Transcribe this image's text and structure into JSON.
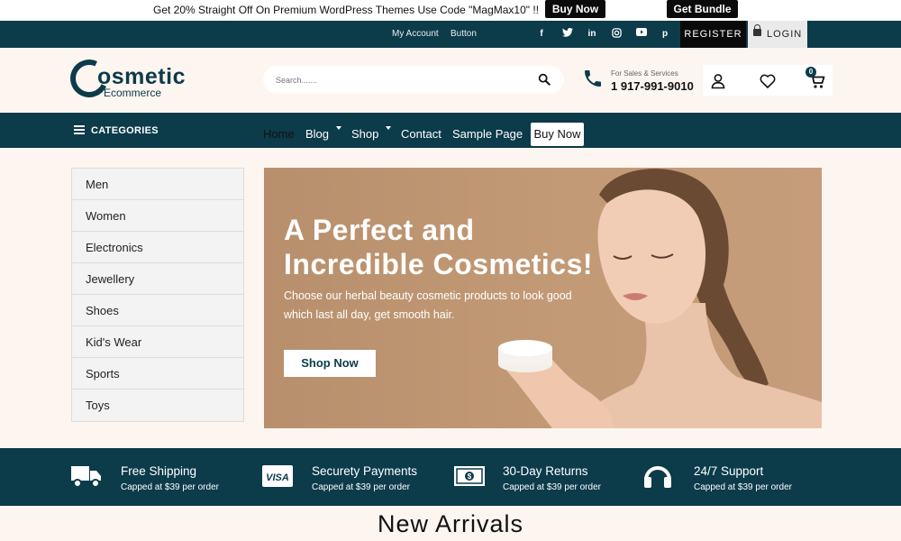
{
  "promo": {
    "text": "Get 20% Straight Off On Premium WordPress Themes Use Code \"MagMax10\" !!",
    "buy_now": "Buy Now",
    "get_bundle": "Get Bundle"
  },
  "topbar": {
    "my_account": "My Account",
    "button": "Button",
    "social": [
      "f",
      "t",
      "in",
      "ig",
      "yt",
      "p"
    ],
    "register": "REGISTER",
    "login": "LOGIN"
  },
  "header": {
    "logo_word": "osmetic",
    "logo_sub": "Ecommerce",
    "search_placeholder": "Search.......",
    "sales_label": "For Sales & Services",
    "phone": "1 917-991-9010",
    "cart_count": "0"
  },
  "nav": {
    "categories": "CATEGORIES",
    "links": [
      "Home",
      "Blog",
      "Shop",
      "Contact",
      "Sample Page"
    ],
    "buy_now": "Buy Now"
  },
  "sidebar": {
    "items": [
      "Men",
      "Women",
      "Electronics",
      "Jewellery",
      "Shoes",
      "Kid's Wear",
      "Sports",
      "Toys"
    ]
  },
  "hero": {
    "title_line1": "A Perfect and",
    "title_line2": "Incredible Cosmetics!",
    "desc_line1": "Choose our herbal beauty cosmetic products to look good",
    "desc_line2": "which last all day, get smooth hair.",
    "button": "Shop Now"
  },
  "features": [
    {
      "title": "Free Shipping",
      "sub": "Capped at $39 per order",
      "icon": "truck-icon"
    },
    {
      "title": "Securety Payments",
      "sub": "Capped at $39 per order",
      "icon": "visa-icon"
    },
    {
      "title": "30-Day Returns",
      "sub": "Capped at $39 per order",
      "icon": "money-icon"
    },
    {
      "title": "24/7 Support",
      "sub": "Capped at $39 per order",
      "icon": "headphones-icon"
    }
  ],
  "arrivals": "New Arrivals",
  "colors": {
    "primary": "#0c3b4a",
    "background": "#fdf5f0",
    "hero": "#c39a76"
  }
}
